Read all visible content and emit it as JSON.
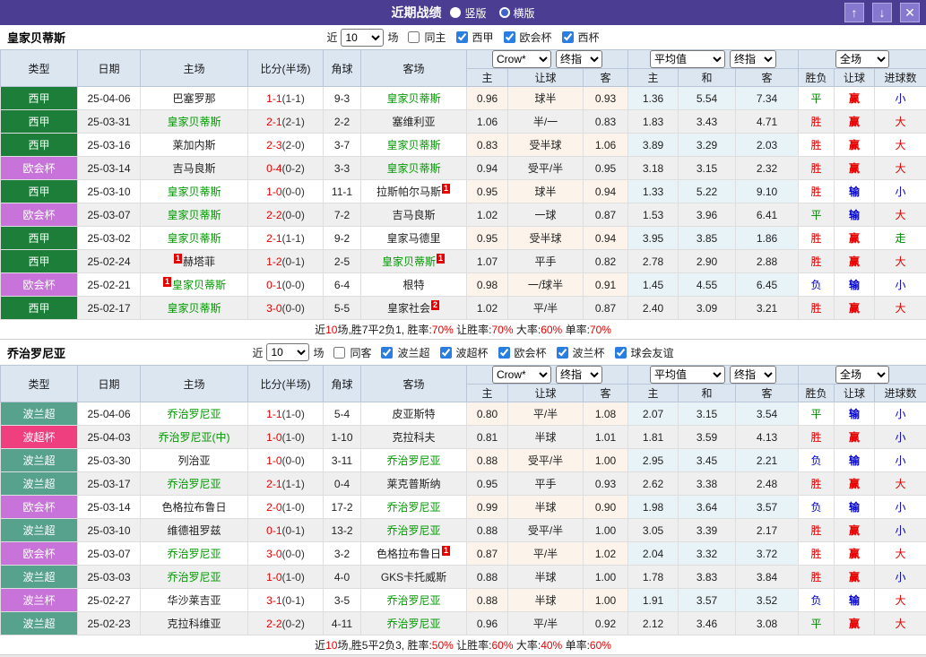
{
  "titlebar": {
    "title": "近期战绩",
    "radio_vertical": "竖版",
    "radio_horizontal": "横版",
    "up_button": "↑",
    "down_button": "↓",
    "close_button": "✕"
  },
  "colors": {
    "titlebar_bg": "#4a3d92",
    "header_bg": "#dce6f1",
    "highlight_team_green": "#009900",
    "score_red": "#e60000",
    "result_red": "#e60000",
    "result_green": "#008800",
    "result_blue": "#0000cc"
  },
  "columns": {
    "type": "类型",
    "date": "日期",
    "home": "主场",
    "score": "比分(半场)",
    "corner": "角球",
    "away": "客场",
    "h": "主",
    "handicap": "让球",
    "a": "客",
    "h2": "主",
    "draw": "和",
    "a2": "客",
    "wl": "胜负",
    "hc": "让球",
    "goals": "进球数"
  },
  "controls": {
    "near": "近",
    "matches": "场",
    "count": "10",
    "crow": "Crow*",
    "final": "终指",
    "avg": "平均值",
    "full": "全场"
  },
  "league_colors": {
    "西甲": "#1d7e3a",
    "欧会杯": "#c873da",
    "波兰超": "#56a28d",
    "波超杯": "#ef3f7e",
    "波兰杯": "#c873da"
  },
  "result_colors": {
    "胜": "#e60000",
    "平": "#008800",
    "负": "#0000cc",
    "赢": "#e60000",
    "输": "#0000cc",
    "走": "#008800",
    "大": "#e60000",
    "小": "#0000cc"
  },
  "sections": [
    {
      "team": "皇家贝蒂斯",
      "count": "10",
      "same_label": "同主",
      "leagues": [
        "西甲",
        "欧会杯",
        "西杯"
      ],
      "rows": [
        {
          "league": "西甲",
          "date": "25-04-06",
          "home": {
            "n": "巴塞罗那"
          },
          "ft": "1-1",
          "ht": "(1-1)",
          "corner": "9-3",
          "away": {
            "n": "皇家贝蒂斯",
            "g": 1
          },
          "odds": [
            "0.96",
            "球半",
            "0.93",
            "1.36",
            "5.54",
            "7.34"
          ],
          "results": [
            "平",
            "赢",
            "小"
          ]
        },
        {
          "league": "西甲",
          "date": "25-03-31",
          "home": {
            "n": "皇家贝蒂斯",
            "g": 1
          },
          "ft": "2-1",
          "ht": "(2-1)",
          "corner": "2-2",
          "away": {
            "n": "塞维利亚"
          },
          "odds": [
            "1.06",
            "半/一",
            "0.83",
            "1.83",
            "3.43",
            "4.71"
          ],
          "results": [
            "胜",
            "赢",
            "大"
          ]
        },
        {
          "league": "西甲",
          "date": "25-03-16",
          "home": {
            "n": "莱加内斯"
          },
          "ft": "2-3",
          "ht": "(2-0)",
          "corner": "3-7",
          "away": {
            "n": "皇家贝蒂斯",
            "g": 1
          },
          "odds": [
            "0.83",
            "受半球",
            "1.06",
            "3.89",
            "3.29",
            "2.03"
          ],
          "results": [
            "胜",
            "赢",
            "大"
          ]
        },
        {
          "league": "欧会杯",
          "date": "25-03-14",
          "home": {
            "n": "吉马良斯"
          },
          "ft": "0-4",
          "ht": "(0-2)",
          "corner": "3-3",
          "away": {
            "n": "皇家贝蒂斯",
            "g": 1
          },
          "odds": [
            "0.94",
            "受平/半",
            "0.95",
            "3.18",
            "3.15",
            "2.32"
          ],
          "results": [
            "胜",
            "赢",
            "大"
          ]
        },
        {
          "league": "西甲",
          "date": "25-03-10",
          "home": {
            "n": "皇家贝蒂斯",
            "g": 1
          },
          "ft": "1-0",
          "ht": "(0-0)",
          "corner": "11-1",
          "away": {
            "n": "拉斯帕尔马斯",
            "ca": "1"
          },
          "odds": [
            "0.95",
            "球半",
            "0.94",
            "1.33",
            "5.22",
            "9.10"
          ],
          "results": [
            "胜",
            "输",
            "小"
          ]
        },
        {
          "league": "欧会杯",
          "date": "25-03-07",
          "home": {
            "n": "皇家贝蒂斯",
            "g": 1
          },
          "ft": "2-2",
          "ht": "(0-0)",
          "corner": "7-2",
          "away": {
            "n": "吉马良斯"
          },
          "odds": [
            "1.02",
            "一球",
            "0.87",
            "1.53",
            "3.96",
            "6.41"
          ],
          "results": [
            "平",
            "输",
            "大"
          ]
        },
        {
          "league": "西甲",
          "date": "25-03-02",
          "home": {
            "n": "皇家贝蒂斯",
            "g": 1
          },
          "ft": "2-1",
          "ht": "(1-1)",
          "corner": "9-2",
          "away": {
            "n": "皇家马德里"
          },
          "odds": [
            "0.95",
            "受半球",
            "0.94",
            "3.95",
            "3.85",
            "1.86"
          ],
          "results": [
            "胜",
            "赢",
            "走"
          ]
        },
        {
          "league": "西甲",
          "date": "25-02-24",
          "home": {
            "n": "赫塔菲",
            "cb": "1"
          },
          "ft": "1-2",
          "ht": "(0-1)",
          "corner": "2-5",
          "away": {
            "n": "皇家贝蒂斯",
            "g": 1,
            "ca": "1"
          },
          "odds": [
            "1.07",
            "平手",
            "0.82",
            "2.78",
            "2.90",
            "2.88"
          ],
          "results": [
            "胜",
            "赢",
            "大"
          ]
        },
        {
          "league": "欧会杯",
          "date": "25-02-21",
          "home": {
            "n": "皇家贝蒂斯",
            "g": 1,
            "cb": "1"
          },
          "ft": "0-1",
          "ht": "(0-0)",
          "corner": "6-4",
          "away": {
            "n": "根特"
          },
          "odds": [
            "0.98",
            "一/球半",
            "0.91",
            "1.45",
            "4.55",
            "6.45"
          ],
          "results": [
            "负",
            "输",
            "小"
          ]
        },
        {
          "league": "西甲",
          "date": "25-02-17",
          "home": {
            "n": "皇家贝蒂斯",
            "g": 1
          },
          "ft": "3-0",
          "ht": "(0-0)",
          "corner": "5-5",
          "away": {
            "n": "皇家社会",
            "ca": "2"
          },
          "odds": [
            "1.02",
            "平/半",
            "0.87",
            "2.40",
            "3.09",
            "3.21"
          ],
          "results": [
            "胜",
            "赢",
            "大"
          ]
        }
      ],
      "summary": [
        [
          "近",
          "k"
        ],
        [
          "10",
          "r"
        ],
        [
          "场,胜7平2负1, 胜率:",
          "k"
        ],
        [
          "70%",
          "r"
        ],
        [
          " 让胜率:",
          "k"
        ],
        [
          "70%",
          "r"
        ],
        [
          " 大率:",
          "k"
        ],
        [
          "60%",
          "r"
        ],
        [
          " 单率:",
          "k"
        ],
        [
          "70%",
          "r"
        ]
      ]
    },
    {
      "team": "乔治罗尼亚",
      "count": "10",
      "same_label": "同客",
      "leagues": [
        "波兰超",
        "波超杯",
        "欧会杯",
        "波兰杯",
        "球会友谊"
      ],
      "rows": [
        {
          "league": "波兰超",
          "date": "25-04-06",
          "home": {
            "n": "乔治罗尼亚",
            "g": 1
          },
          "ft": "1-1",
          "ht": "(1-0)",
          "corner": "5-4",
          "away": {
            "n": "皮亚斯特"
          },
          "odds": [
            "0.80",
            "平/半",
            "1.08",
            "2.07",
            "3.15",
            "3.54"
          ],
          "results": [
            "平",
            "输",
            "小"
          ]
        },
        {
          "league": "波超杯",
          "date": "25-04-03",
          "home": {
            "n": "乔治罗尼亚(中)",
            "g": 1
          },
          "ft": "1-0",
          "ht": "(1-0)",
          "corner": "1-10",
          "away": {
            "n": "克拉科夫"
          },
          "odds": [
            "0.81",
            "半球",
            "1.01",
            "1.81",
            "3.59",
            "4.13"
          ],
          "results": [
            "胜",
            "赢",
            "小"
          ]
        },
        {
          "league": "波兰超",
          "date": "25-03-30",
          "home": {
            "n": "列治亚"
          },
          "ft": "1-0",
          "ht": "(0-0)",
          "corner": "3-11",
          "away": {
            "n": "乔治罗尼亚",
            "g": 1
          },
          "odds": [
            "0.88",
            "受平/半",
            "1.00",
            "2.95",
            "3.45",
            "2.21"
          ],
          "results": [
            "负",
            "输",
            "小"
          ]
        },
        {
          "league": "波兰超",
          "date": "25-03-17",
          "home": {
            "n": "乔治罗尼亚",
            "g": 1
          },
          "ft": "2-1",
          "ht": "(1-1)",
          "corner": "0-4",
          "away": {
            "n": "莱克普斯纳"
          },
          "odds": [
            "0.95",
            "平手",
            "0.93",
            "2.62",
            "3.38",
            "2.48"
          ],
          "results": [
            "胜",
            "赢",
            "大"
          ]
        },
        {
          "league": "欧会杯",
          "date": "25-03-14",
          "home": {
            "n": "色格拉布鲁日"
          },
          "ft": "2-0",
          "ht": "(1-0)",
          "corner": "17-2",
          "away": {
            "n": "乔治罗尼亚",
            "g": 1
          },
          "odds": [
            "0.99",
            "半球",
            "0.90",
            "1.98",
            "3.64",
            "3.57"
          ],
          "results": [
            "负",
            "输",
            "小"
          ]
        },
        {
          "league": "波兰超",
          "date": "25-03-10",
          "home": {
            "n": "维德祖罗兹"
          },
          "ft": "0-1",
          "ht": "(0-1)",
          "corner": "13-2",
          "away": {
            "n": "乔治罗尼亚",
            "g": 1
          },
          "odds": [
            "0.88",
            "受平/半",
            "1.00",
            "3.05",
            "3.39",
            "2.17"
          ],
          "results": [
            "胜",
            "赢",
            "小"
          ]
        },
        {
          "league": "欧会杯",
          "date": "25-03-07",
          "home": {
            "n": "乔治罗尼亚",
            "g": 1
          },
          "ft": "3-0",
          "ht": "(0-0)",
          "corner": "3-2",
          "away": {
            "n": "色格拉布鲁日",
            "ca": "1"
          },
          "odds": [
            "0.87",
            "平/半",
            "1.02",
            "2.04",
            "3.32",
            "3.72"
          ],
          "results": [
            "胜",
            "赢",
            "大"
          ]
        },
        {
          "league": "波兰超",
          "date": "25-03-03",
          "home": {
            "n": "乔治罗尼亚",
            "g": 1
          },
          "ft": "1-0",
          "ht": "(1-0)",
          "corner": "4-0",
          "away": {
            "n": "GKS卡托威斯"
          },
          "odds": [
            "0.88",
            "半球",
            "1.00",
            "1.78",
            "3.83",
            "3.84"
          ],
          "results": [
            "胜",
            "赢",
            "小"
          ]
        },
        {
          "league": "波兰杯",
          "date": "25-02-27",
          "home": {
            "n": "华沙莱吉亚"
          },
          "ft": "3-1",
          "ht": "(0-1)",
          "corner": "3-5",
          "away": {
            "n": "乔治罗尼亚",
            "g": 1
          },
          "odds": [
            "0.88",
            "半球",
            "1.00",
            "1.91",
            "3.57",
            "3.52"
          ],
          "results": [
            "负",
            "输",
            "大"
          ]
        },
        {
          "league": "波兰超",
          "date": "25-02-23",
          "home": {
            "n": "克拉科维亚"
          },
          "ft": "2-2",
          "ht": "(0-2)",
          "corner": "4-11",
          "away": {
            "n": "乔治罗尼亚",
            "g": 1
          },
          "odds": [
            "0.96",
            "平/半",
            "0.92",
            "2.12",
            "3.46",
            "3.08"
          ],
          "results": [
            "平",
            "赢",
            "大"
          ]
        }
      ],
      "summary": [
        [
          "近",
          "k"
        ],
        [
          "10",
          "r"
        ],
        [
          "场,胜5平2负3, 胜率:",
          "k"
        ],
        [
          "50%",
          "r"
        ],
        [
          " 让胜率:",
          "k"
        ],
        [
          "60%",
          "r"
        ],
        [
          " 大率:",
          "k"
        ],
        [
          "40%",
          "r"
        ],
        [
          " 单率:",
          "k"
        ],
        [
          "60%",
          "r"
        ]
      ]
    }
  ]
}
